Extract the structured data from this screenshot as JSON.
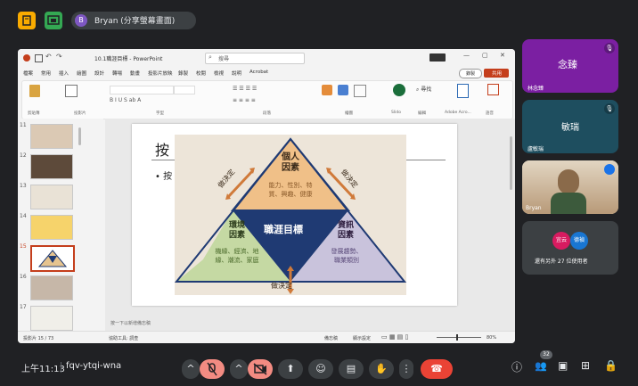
{
  "meeting": {
    "presenter_label": "Bryan (分享螢幕畫面)",
    "presenter_initial": "B",
    "time": "上午11:13",
    "meeting_code": "fqv-ytqi-wna",
    "participant_count": "32"
  },
  "colors": {
    "accent_yellow": "#f9ab00",
    "accent_green": "#34a853",
    "danger": "#ea4335",
    "tile_purple": "#7b1fa2",
    "tile_teal": "#1e4e5f"
  },
  "ppt": {
    "window_title": "10.1職涯目標 - PowerPoint",
    "search_label": "搜尋",
    "menu": [
      "檔案",
      "常用",
      "插入",
      "繪圖",
      "設計",
      "轉場",
      "動畫",
      "投影片放映",
      "錄製",
      "校閱",
      "檢視",
      "說明",
      "Acrobat"
    ],
    "record_label": "錄製",
    "share_label": "共用",
    "ribbon_groups": [
      "剪貼簿",
      "投影片",
      "字型",
      "段落",
      "繪圖",
      "Slido",
      "編輯",
      "Adobe Acro...",
      "語音"
    ],
    "slide_numbers": [
      "11",
      "12",
      "13",
      "14",
      "15",
      "16",
      "17"
    ],
    "slide_title_partial": "按",
    "slide_bullet_partial": "• 按",
    "notes_placeholder": "按一下以新增備忘稿",
    "status_left": "投影片 15 / 73",
    "status_accessibility": "協助工具: 調查",
    "status_notes": "備忘稿",
    "status_display": "顯示設定",
    "zoom": "80%"
  },
  "diagram": {
    "top_title": "個人\n因素",
    "top_body": "能力、性別、特\n質、興趣、健康",
    "left_title": "環境\n因素",
    "left_body": "機緣、經濟、地\n緣、潮流、家庭",
    "right_title": "資訊\n因素",
    "right_body": "發展趨勢、\n職業類別",
    "center": "職涯目標",
    "arrow_left": "做決定",
    "arrow_right": "做決定",
    "arrow_bottom": "做決定"
  },
  "participants": [
    {
      "avatar_text": "念臻",
      "name": "林念臻"
    },
    {
      "avatar_text": "敏瑞",
      "name": "盧敏瑞"
    },
    {
      "name": "Bryan"
    }
  ],
  "others": {
    "avatar1": "宜云",
    "avatar2": "德禎",
    "label": "還有另外 27 位使用者"
  }
}
